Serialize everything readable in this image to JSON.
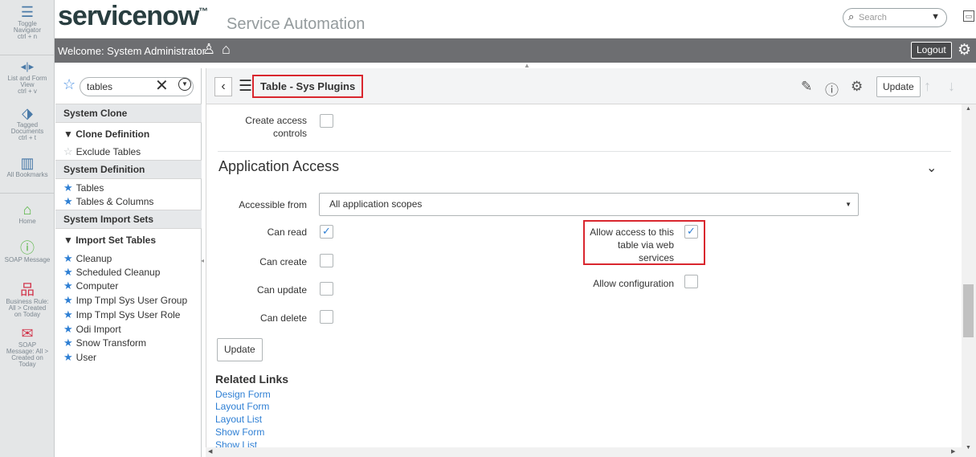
{
  "rail": {
    "items": [
      {
        "icon": "toggle-navigator-icon",
        "glyph": "☰",
        "label": "Toggle\nNavigator\nctrl + n"
      },
      {
        "icon": "list-form-view-icon",
        "glyph": "◂|▸",
        "label": "List and Form\nView\nctrl + v"
      },
      {
        "icon": "tagged-documents-icon",
        "glyph": "⬗",
        "label": "Tagged\nDocuments\nctrl + t"
      },
      {
        "icon": "bookmarks-icon",
        "glyph": "▥",
        "label": "All Bookmarks"
      },
      {
        "icon": "home-icon",
        "glyph": "⌂",
        "label": "Home"
      },
      {
        "icon": "info-icon",
        "glyph": "ⓘ",
        "label": "SOAP Message"
      },
      {
        "icon": "hierarchy-icon",
        "glyph": "品",
        "label": "Business Rule:\nAll > Created\non Today"
      },
      {
        "icon": "envelope-icon",
        "glyph": "✉",
        "label": "SOAP\nMessage: All >\nCreated on\nToday"
      }
    ]
  },
  "header": {
    "logo": "servicenow",
    "logo_tm": "™",
    "app_title": "Service Automation",
    "search_placeholder": "Search"
  },
  "welcome": {
    "text": "Welcome:  System Administrator",
    "logout": "Logout"
  },
  "nav": {
    "filter_value": "tables",
    "sections": [
      {
        "label": "System Clone"
      },
      {
        "label": "System Definition"
      },
      {
        "label": "System Import Sets"
      }
    ],
    "clone_group": "▼  Clone Definition",
    "clone_items": [
      "Exclude Tables"
    ],
    "definition_items": [
      "Tables",
      "Tables & Columns"
    ],
    "import_group": "▼  Import Set Tables",
    "import_items": [
      "Cleanup",
      "Scheduled Cleanup",
      "Computer",
      "Imp Tmpl Sys User Group",
      "Imp Tmpl Sys User Role",
      "Odi Import",
      "Snow Transform",
      "User"
    ]
  },
  "form": {
    "title": "Table - Sys Plugins",
    "update_label": "Update",
    "create_access_label": "Create access controls",
    "section_title": "Application Access",
    "accessible_from_label": "Accessible from",
    "accessible_from_value": "All application scopes",
    "can_read_label": "Can read",
    "can_read": true,
    "can_create_label": "Can create",
    "can_create": false,
    "can_update_label": "Can update",
    "can_update": false,
    "can_delete_label": "Can delete",
    "can_delete": false,
    "web_services_label": "Allow access to this table via web services",
    "web_services": true,
    "allow_config_label": "Allow configuration",
    "allow_config": false,
    "create_access": false
  },
  "related": {
    "title": "Related Links",
    "links": [
      "Design Form",
      "Layout Form",
      "Layout List",
      "Show Form",
      "Show List"
    ]
  },
  "colors": {
    "brand_dark": "#293e40",
    "highlight_red": "#d9262e",
    "link_blue": "#2e7fd4",
    "welcome_bar": "#6d6e71"
  }
}
